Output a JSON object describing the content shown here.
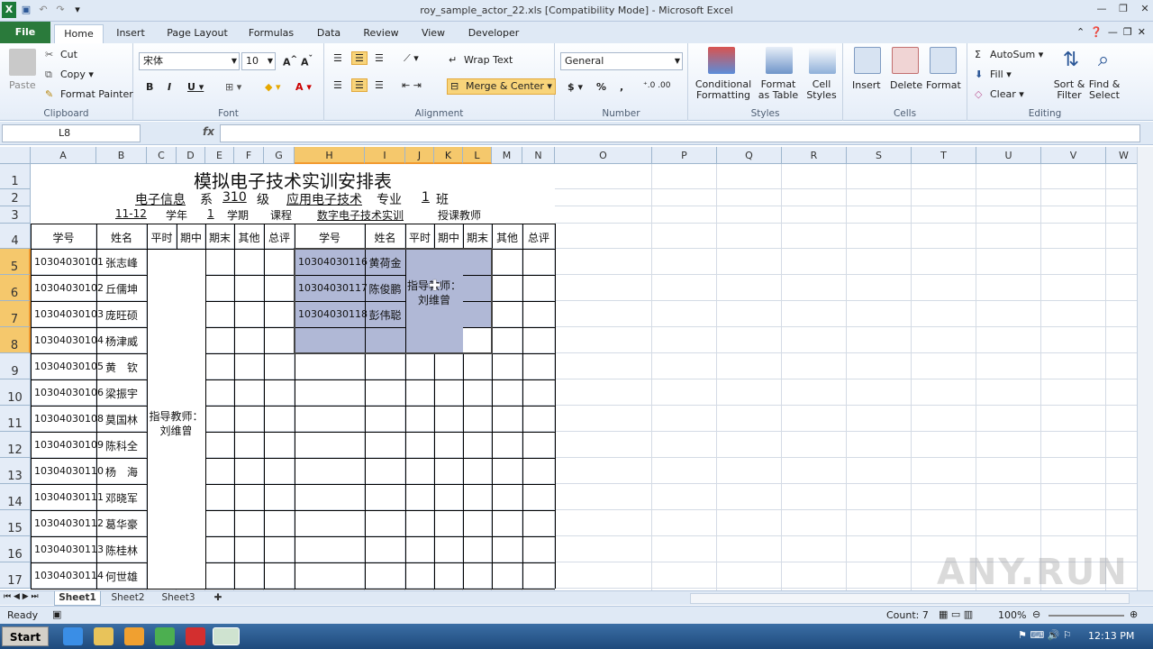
{
  "window": {
    "title": "roy_sample_actor_22.xls  [Compatibility Mode]  -  Microsoft Excel"
  },
  "tabs": [
    "File",
    "Home",
    "Insert",
    "Page Layout",
    "Formulas",
    "Data",
    "Review",
    "View",
    "Developer"
  ],
  "clipboard": {
    "paste": "Paste",
    "cut": "Cut",
    "copy": "Copy",
    "format_painter": "Format Painter",
    "group": "Clipboard"
  },
  "font": {
    "name": "宋体",
    "size": "10",
    "group": "Font"
  },
  "alignment": {
    "wrap": "Wrap Text",
    "merge": "Merge & Center",
    "group": "Alignment"
  },
  "number": {
    "format": "General",
    "group": "Number",
    "currency": "$",
    "percent": "%",
    "comma": ","
  },
  "styles": {
    "conditional": "Conditional Formatting",
    "format_table": "Format as Table",
    "cell_styles": "Cell Styles",
    "group": "Styles"
  },
  "cells": {
    "insert": "Insert",
    "delete": "Delete",
    "format": "Format",
    "group": "Cells"
  },
  "editing": {
    "autosum": "AutoSum",
    "fill": "Fill",
    "clear": "Clear",
    "sort": "Sort & Filter",
    "find": "Find & Select",
    "group": "Editing"
  },
  "formula_bar": {
    "name_box": "L8",
    "fx": "fx",
    "value": ""
  },
  "columns": [
    "A",
    "B",
    "C",
    "D",
    "E",
    "F",
    "G",
    "H",
    "I",
    "J",
    "K",
    "L",
    "M",
    "N",
    "O",
    "P",
    "Q",
    "R",
    "S",
    "T",
    "U",
    "V",
    "W"
  ],
  "rows": [
    "1",
    "2",
    "3",
    "4",
    "5",
    "6",
    "7",
    "8",
    "9",
    "10",
    "11",
    "12",
    "13",
    "14",
    "15",
    "16",
    "17"
  ],
  "sheet": {
    "title": "模拟电子技术实训安排表",
    "row2": [
      "电子信息",
      "系",
      "310",
      "级",
      "应用电子技术",
      "专业",
      "1",
      "班"
    ],
    "row3": [
      "11-12",
      "学年",
      "1",
      "学期",
      "课程",
      "数字电子技术实训",
      "授课教师"
    ],
    "headers_left": [
      "学号",
      "姓名",
      "平时",
      "期中",
      "期末",
      "其他",
      "总评"
    ],
    "headers_right": [
      "学号",
      "姓名",
      "平时",
      "期中",
      "期末",
      "其他",
      "总评"
    ],
    "left_students": [
      {
        "id": "10304030101",
        "name": "张志峰"
      },
      {
        "id": "10304030102",
        "name": "丘儒坤"
      },
      {
        "id": "10304030103",
        "name": "庞旺硕"
      },
      {
        "id": "10304030104",
        "name": "杨津威"
      },
      {
        "id": "10304030105",
        "name": "黄　钦"
      },
      {
        "id": "10304030106",
        "name": "梁振宇"
      },
      {
        "id": "10304030108",
        "name": "莫国林"
      },
      {
        "id": "10304030109",
        "name": "陈科全"
      },
      {
        "id": "10304030110",
        "name": "杨　海"
      },
      {
        "id": "10304030111",
        "name": "邓晓军"
      },
      {
        "id": "10304030112",
        "name": "葛华豪"
      },
      {
        "id": "10304030113",
        "name": "陈桂林"
      },
      {
        "id": "10304030114",
        "name": "何世雄"
      }
    ],
    "right_students": [
      {
        "id": "10304030116",
        "name": "黄荷金"
      },
      {
        "id": "10304030117",
        "name": "陈俊鹏"
      },
      {
        "id": "10304030118",
        "name": "彭伟聪"
      }
    ],
    "instructor_left": "指导教师：刘维曾",
    "instructor_right": "指导教师：刘维曾"
  },
  "sheets": [
    "Sheet1",
    "Sheet2",
    "Sheet3"
  ],
  "status": {
    "ready": "Ready",
    "count": "Count: 7",
    "zoom": "100%"
  },
  "taskbar": {
    "start": "Start",
    "time": "12:13 PM"
  },
  "watermark": "ANY.RUN"
}
